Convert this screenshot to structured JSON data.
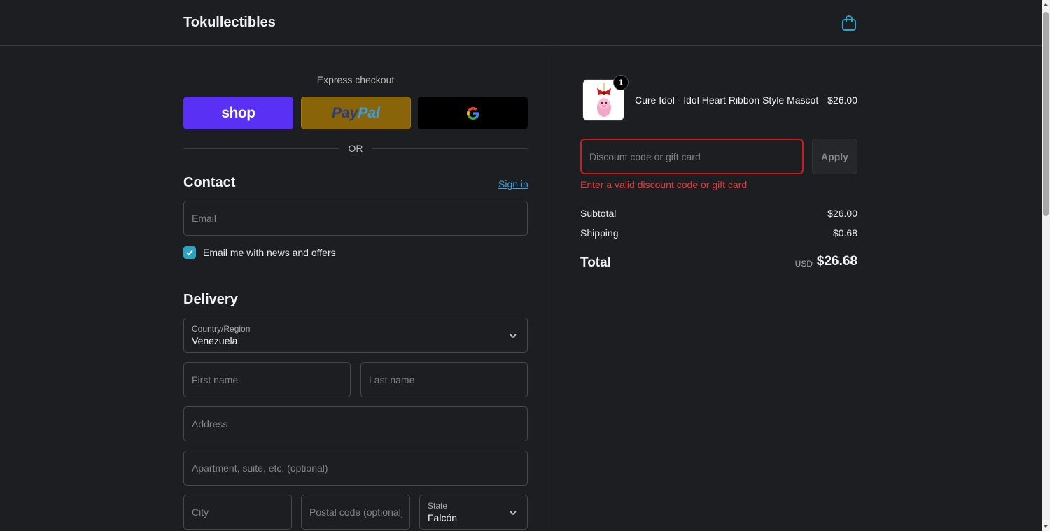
{
  "header": {
    "brand": "Tokullectibles",
    "cart_icon": "shopping-bag-icon",
    "accent_color": "#2aa3c7"
  },
  "express": {
    "title": "Express checkout",
    "shop_label": "shop",
    "paypal_label_1": "Pay",
    "paypal_label_2": "Pal",
    "gpay_icon": "google-g-icon",
    "or_label": "OR"
  },
  "contact": {
    "title": "Contact",
    "sign_in": "Sign in",
    "email_placeholder": "Email",
    "newsletter_label": "Email me with news and offers",
    "newsletter_checked": true
  },
  "delivery": {
    "title": "Delivery",
    "country_label": "Country/Region",
    "country_value": "Venezuela",
    "first_name_placeholder": "First name",
    "last_name_placeholder": "Last name",
    "address_placeholder": "Address",
    "apartment_placeholder": "Apartment, suite, etc. (optional)",
    "city_placeholder": "City",
    "postal_placeholder": "Postal code (optional)",
    "state_label": "State",
    "state_value": "Falcón"
  },
  "order": {
    "item_name": "Cure Idol - Idol Heart Ribbon Style Mascot",
    "item_price": "$26.00",
    "item_qty": "1",
    "discount_placeholder": "Discount code or gift card",
    "apply_label": "Apply",
    "discount_error": "Enter a valid discount code or gift card",
    "error_color": "#e63a3a",
    "subtotal_label": "Subtotal",
    "subtotal_value": "$26.00",
    "shipping_label": "Shipping",
    "shipping_value": "$0.68",
    "total_label": "Total",
    "total_currency": "USD",
    "total_value": "$26.68"
  }
}
